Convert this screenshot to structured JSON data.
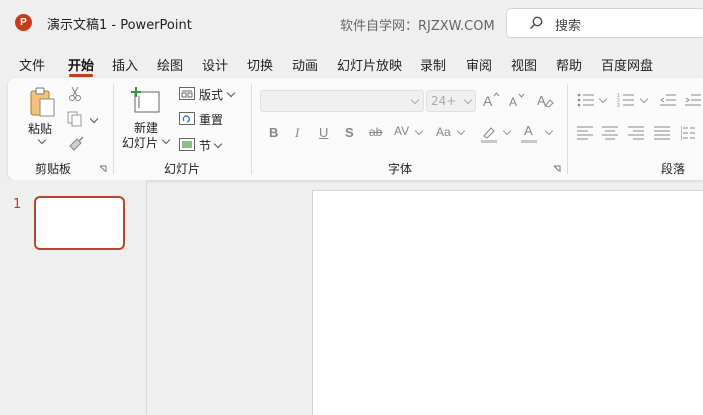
{
  "title_bar": {
    "logo_letter": "P",
    "document_title": "演示文稿1  -  PowerPoint",
    "site_watermark": "软件自学网：RJZXW.COM",
    "search_placeholder": "搜索"
  },
  "menu_tabs": [
    {
      "label": "文件",
      "active": false
    },
    {
      "label": "开始",
      "active": true
    },
    {
      "label": "插入",
      "active": false
    },
    {
      "label": "绘图",
      "active": false
    },
    {
      "label": "设计",
      "active": false
    },
    {
      "label": "切换",
      "active": false
    },
    {
      "label": "动画",
      "active": false
    },
    {
      "label": "幻灯片放映",
      "active": false
    },
    {
      "label": "录制",
      "active": false
    },
    {
      "label": "审阅",
      "active": false
    },
    {
      "label": "视图",
      "active": false
    },
    {
      "label": "帮助",
      "active": false
    },
    {
      "label": "百度网盘",
      "active": false
    }
  ],
  "ribbon": {
    "clipboard": {
      "group_label": "剪贴板",
      "paste_label": "粘贴"
    },
    "slides": {
      "group_label": "幻灯片",
      "new_slide_line1": "新建",
      "new_slide_line2": "幻灯片",
      "layout_label": "版式",
      "reset_label": "重置",
      "section_label": "节"
    },
    "font": {
      "group_label": "字体",
      "font_name_value": "",
      "font_size_value": "24+",
      "bold": "B",
      "italic": "I",
      "underline": "U",
      "shadow": "S",
      "strikethrough": "ab",
      "char_spacing": "AV",
      "change_case": "Aa",
      "font_color": "A"
    },
    "paragraph": {
      "group_label": "段落"
    }
  },
  "slides_pane": {
    "slide_number": "1"
  },
  "colors": {
    "accent": "#c43e1c",
    "selection_border": "#b7472a",
    "ribbon_bg": "#fafafa",
    "window_bg": "#efefef"
  }
}
